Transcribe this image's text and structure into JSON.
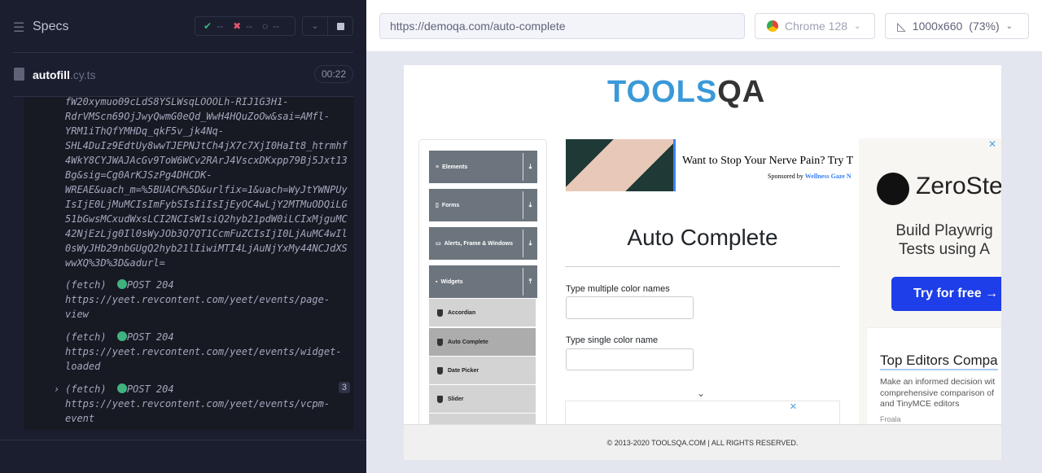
{
  "runner": {
    "specs_label": "Specs",
    "passed": "--",
    "failed": "--",
    "pending": "--",
    "spec_file": "autofill",
    "spec_ext": ".cy.ts",
    "duration": "00:22"
  },
  "log": {
    "url_lines": [
      "fW20xymuo09cLdS8YSLWsqLOOOLh-RIJ1G3H1-",
      "RdrVMScn69OjJwyQwmG0eQd_WwH4HQuZoOw&sai=AMfl-",
      "YRM1iThQfYMHDq_qkF5v_jk4Nq-",
      "SHL4DuIz9EdtUy8wwTJEPNJtCh4jX7c7XjI0HaIt8_htrmhf",
      "4WkY8CYJWAJAcGv9ToW6WCv2RArJ4VscxDKxpp79Bj5Jxt13",
      "Bg&sig=Cg0ArKJSzPg4DHCDK-",
      "WREAE&uach_m=%5BUACH%5D&urlfix=1&uach=WyJtYWNPUy",
      "IsIjE0LjMuMCIsImFybSIsIiIsIjEyOC4wLjY2MTMuODQiLG",
      "51bGwsMCxudWxsLCI2NCIsW1siQ2hyb21pdW0iLCIxMjguMC",
      "42NjEzLjg0Il0sWyJOb3Q7QT1CcmFuZCIsIjI0LjAuMC4wIl",
      "0sWyJHb29nbGUgQ2hyb21lIiwiMTI4LjAuNjYxMy44NCJdXS",
      "wwXQ%3D%3D&adurl="
    ],
    "entries": [
      {
        "type": "(fetch)",
        "status": "POST 204",
        "url1": "https://yeet.revcontent.com/yeet/events/page-",
        "url2": "view"
      },
      {
        "type": "(fetch)",
        "status": "POST 204",
        "url1": "https://yeet.revcontent.com/yeet/events/widget-",
        "url2": "loaded"
      },
      {
        "type": "(fetch)",
        "status": "POST 204",
        "url1": "https://yeet.revcontent.com/yeet/events/vcpm-",
        "url2": "event",
        "count": "3"
      }
    ]
  },
  "browser": {
    "url": "https://demoqa.com/auto-complete",
    "browser_name": "Chrome 128",
    "viewport": "1000x660",
    "zoom": "(73%)"
  },
  "page": {
    "logo": "TOOLSQA",
    "menu": [
      {
        "label": "Elements"
      },
      {
        "label": "Forms"
      },
      {
        "label": "Alerts, Frame & Windows"
      },
      {
        "label": "Widgets"
      }
    ],
    "submenu": [
      "Accordian",
      "Auto Complete",
      "Date Picker",
      "Slider"
    ],
    "ad": {
      "headline": "Want to Stop Your Nerve Pain? Try T",
      "sponsored": "Sponsored by",
      "sponsor": "Wellness Gaze N"
    },
    "title": "Auto Complete",
    "label_multiple": "Type multiple color names",
    "label_single": "Type single color name",
    "side_ad": {
      "brand": "ZeroSte",
      "tagline1": "Build Playwrig",
      "tagline2": "Tests using A",
      "cta": "Try for free →",
      "title": "Top Editors Compa",
      "desc1": "Make an informed decision wit",
      "desc2": "comprehensive comparison of",
      "desc3": "and TinyMCE editors",
      "source": "Froala"
    },
    "footer": "© 2013-2020 TOOLSQA.COM | ALL RIGHTS RESERVED."
  }
}
